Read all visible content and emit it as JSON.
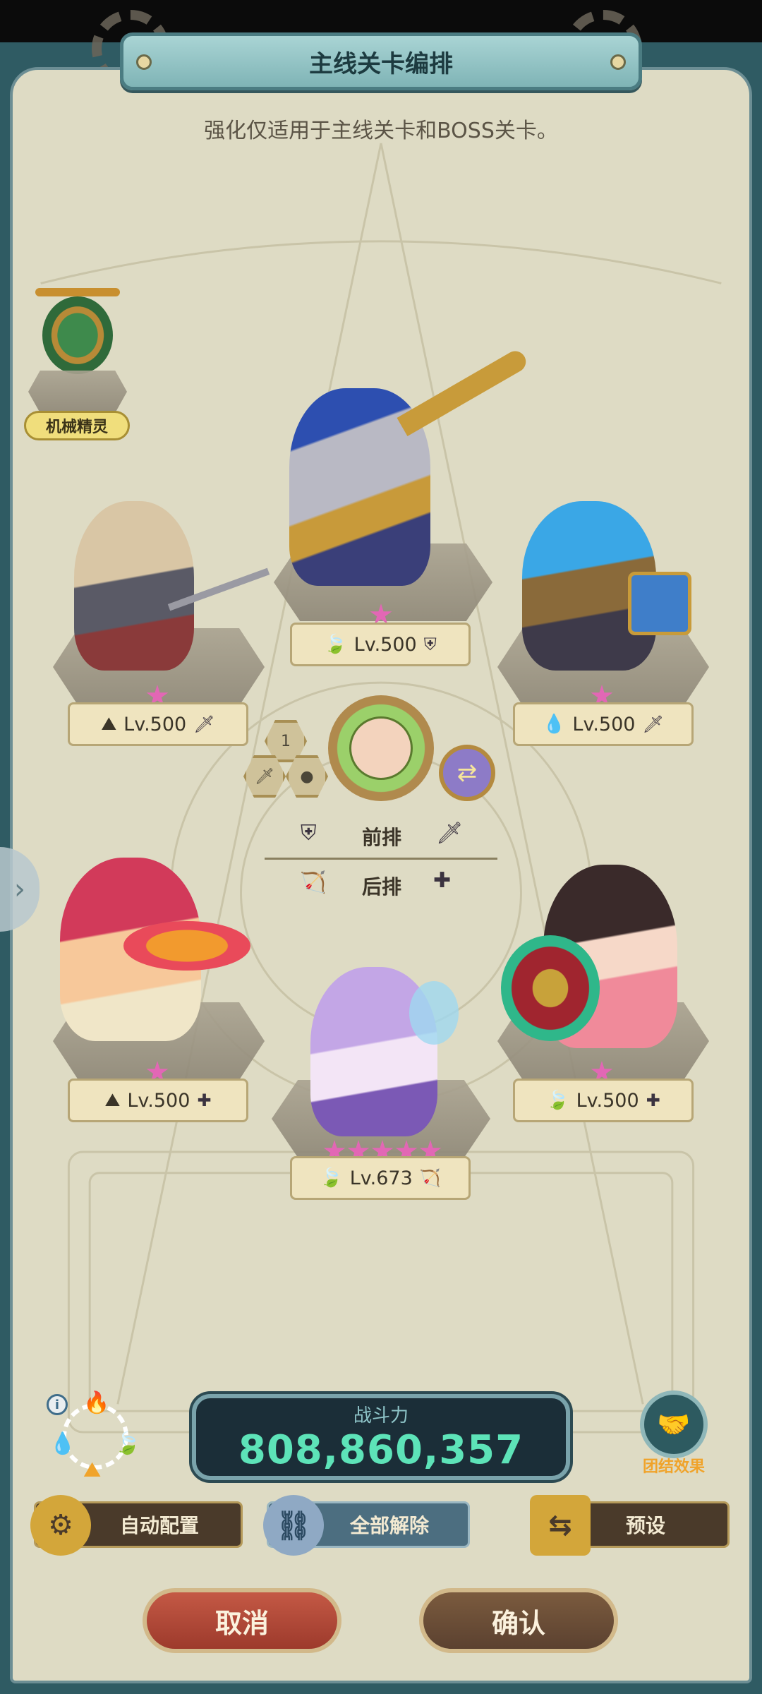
{
  "header": {
    "title": "主线关卡编排",
    "subtitle": "强化仅适用于主线关卡和BOSS关卡。"
  },
  "spirit": {
    "label": "机械精灵",
    "icon": "mech-spirit-icon"
  },
  "heroes": [
    {
      "slot": "front-center",
      "level": "Lv.500",
      "element": "wind",
      "role": "shield",
      "stars": 1
    },
    {
      "slot": "front-left",
      "level": "Lv.500",
      "element": "earth",
      "role": "sword",
      "stars": 1
    },
    {
      "slot": "front-right",
      "level": "Lv.500",
      "element": "water",
      "role": "sword",
      "stars": 1
    },
    {
      "slot": "back-left",
      "level": "Lv.500",
      "element": "earth",
      "role": "heal",
      "stars": 1
    },
    {
      "slot": "back-center",
      "level": "Lv.673",
      "element": "wind",
      "role": "bow",
      "stars": 5
    },
    {
      "slot": "back-right",
      "level": "Lv.500",
      "element": "wind",
      "role": "heal",
      "stars": 1
    }
  ],
  "leader": {
    "badge": "1"
  },
  "rows": {
    "front_label": "前排",
    "back_label": "后排"
  },
  "power": {
    "label": "战斗力",
    "value": "808,860,357"
  },
  "team_effect": {
    "label": "团结效果"
  },
  "buttons": {
    "auto": "自动配置",
    "clear": "全部解除",
    "preset": "预设",
    "cancel": "取消",
    "confirm": "确认"
  },
  "colors": {
    "panel": "#dedbc4",
    "frame": "#2f5b63",
    "star": "#e267b5",
    "power_text": "#5de3b8",
    "cancel": "#b34a37",
    "confirm": "#6b4e37"
  }
}
